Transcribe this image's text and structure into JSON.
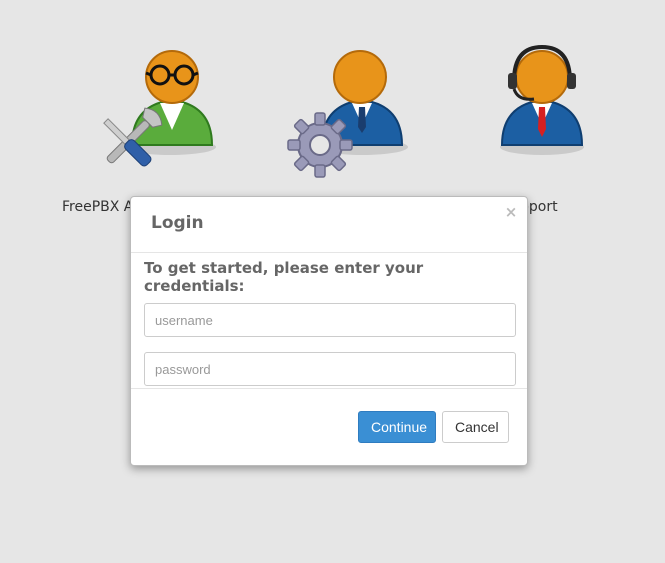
{
  "tiles": {
    "admin": {
      "label": "FreePBX Ac",
      "icon": "admin-user-icon"
    },
    "user": {
      "icon": "user-settings-icon"
    },
    "support": {
      "label": "pport",
      "icon": "support-agent-icon"
    }
  },
  "modal": {
    "title": "Login",
    "close_glyph": "×",
    "prompt": "To get started, please enter your credentials:",
    "username_placeholder": "username",
    "password_placeholder": "password",
    "continue_label": "Continue",
    "cancel_label": "Cancel"
  },
  "colors": {
    "background": "#e6e6e6",
    "primary_button": "#3a8fd4",
    "head_orange": "#e8941a",
    "admin_body_green": "#5aac3c",
    "body_blue": "#1c5fa3"
  }
}
